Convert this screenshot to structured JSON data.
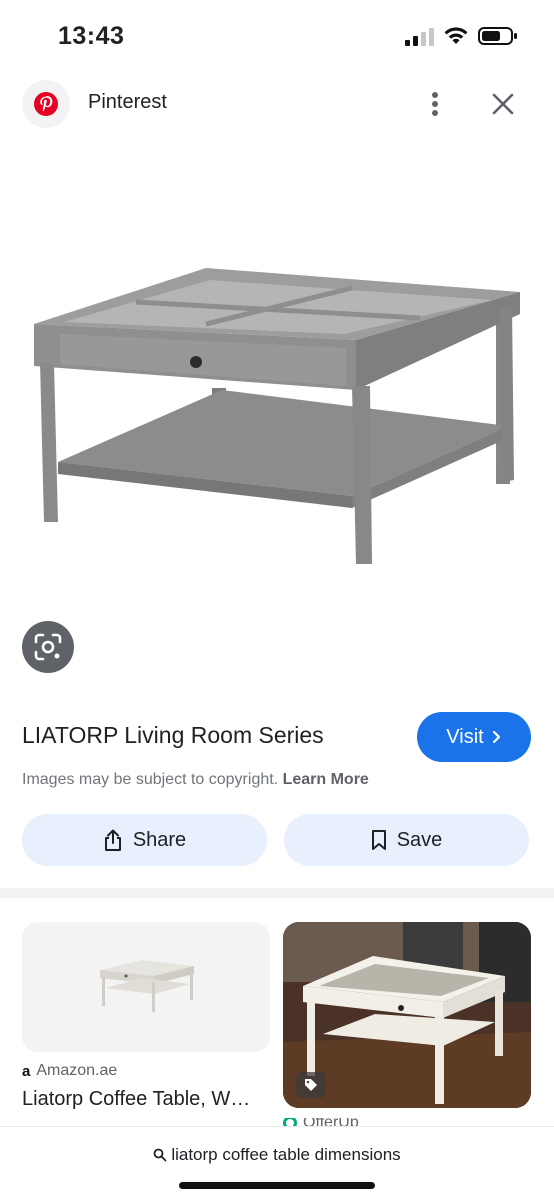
{
  "status_bar": {
    "time": "13:43",
    "icons": [
      "signal-icon",
      "wifi-icon",
      "battery-icon"
    ]
  },
  "header": {
    "source_name": "Pinterest",
    "source_icon": "pinterest-logo-icon",
    "menu_icon": "more-vert-icon",
    "close_icon": "close-icon"
  },
  "main": {
    "image_alt": "gray coffee table with glass top",
    "lens_icon": "lens-icon",
    "title": "LIATORP Living Room Series",
    "visit_label": "Visit",
    "copyright_text": "Images may be subject to copyright. ",
    "learn_more": "Learn More",
    "share_label": "Share",
    "save_label": "Save"
  },
  "related": [
    {
      "source": "Amazon.ae",
      "title": "Liatorp Coffee Table, W…",
      "source_icon": "amazon-icon"
    },
    {
      "source": "OfferUp",
      "tag_icon": "tag-icon"
    }
  ],
  "bottom_bar": {
    "query": "liatorp coffee table dimensions",
    "icon": "search-icon"
  },
  "colors": {
    "accent": "#1a73e8",
    "chip_bg": "#e8f0fe",
    "pinterest_red": "#e60023"
  }
}
